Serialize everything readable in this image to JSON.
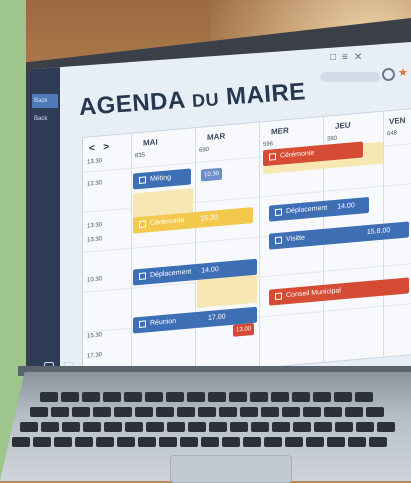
{
  "sidebar": {
    "items": [
      "Back",
      "Back"
    ]
  },
  "header": {
    "title_main": "AGENDA",
    "title_small": "DU",
    "title_end": "MAIRE",
    "window_controls": [
      "□",
      "≡",
      "✕"
    ]
  },
  "calendar": {
    "nav_prev": "<",
    "nav_next": ">",
    "days": [
      "MAI",
      "MAR",
      "MER",
      "JEU",
      "VEN"
    ],
    "day_numbers": [
      "835",
      "680",
      "596",
      "380",
      "648"
    ],
    "times": [
      "13.30",
      "12.30",
      "13:30",
      "13.30",
      "10.30",
      "15.30",
      "17.30"
    ],
    "events": [
      {
        "label": "Méting",
        "color": "blue"
      },
      {
        "label": "Cérémonie",
        "color": "red"
      },
      {
        "label": "Cérémonie",
        "color": "yellow",
        "time": "15.30"
      },
      {
        "label": "Déplacement",
        "color": "blue",
        "time": "14.00"
      },
      {
        "label": "Visitte",
        "color": "blue",
        "time": "15.8.00"
      },
      {
        "label": "Déplacement",
        "color": "blue",
        "time": "14.00"
      },
      {
        "label": "Réunion",
        "color": "blue",
        "time": "17.00"
      },
      {
        "label": "Conseil Municipal",
        "color": "red"
      }
    ],
    "small_times": [
      "10.30",
      "13.00"
    ]
  },
  "colors": {
    "blue": "#3e6fb5",
    "red": "#d64b34",
    "yellow": "#f2c94c",
    "frame": "#9ec58c"
  }
}
